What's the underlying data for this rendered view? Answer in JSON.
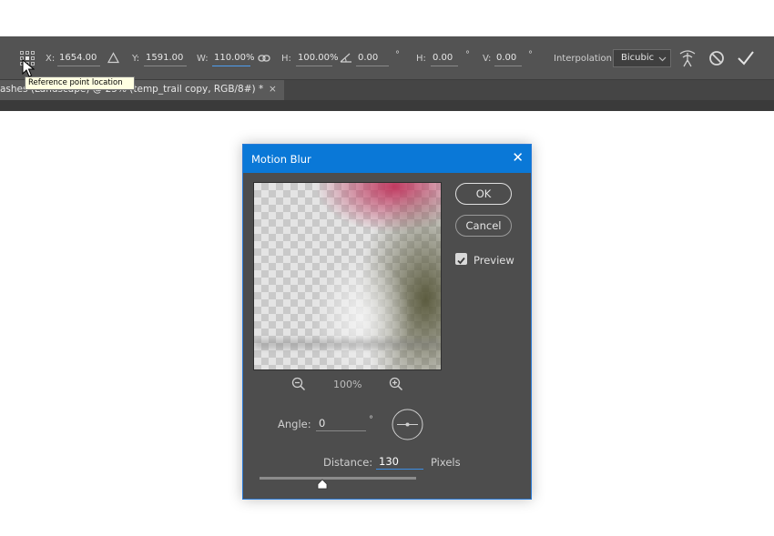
{
  "options_bar": {
    "ref_point_icon": "reference-point-grid-icon",
    "x_label": "X:",
    "x_value": "1654.00 px",
    "delta_icon": "triangle-delta-icon",
    "y_label": "Y:",
    "y_value": "1591.00 px",
    "w_label": "W:",
    "w_value": "110.00%",
    "link_icon": "chain-link-icon",
    "h_label": "H:",
    "h_value": "100.00%",
    "rotate_icon": "angle-icon",
    "rotate_value": "0.00",
    "rotate_unit": "°",
    "hskew_label": "H:",
    "hskew_value": "0.00",
    "hskew_unit": "°",
    "vskew_label": "V:",
    "vskew_value": "0.00",
    "vskew_unit": "°",
    "interpolation_label": "Interpolation:",
    "interpolation_value": "Bicubic",
    "warp_icon": "warp-mode-icon",
    "cancel_icon": "cancel-transform-icon",
    "commit_icon": "commit-transform-icon"
  },
  "tooltip": {
    "text": "Reference point location"
  },
  "document_tab": {
    "title": "ashes (Landscape) @ 25% (temp_trail copy, RGB/8#) *",
    "close": "×"
  },
  "dialog": {
    "title": "Motion Blur",
    "close": "✕",
    "ok_label": "OK",
    "cancel_label": "Cancel",
    "preview_label": "Preview",
    "preview_checked": true,
    "zoom_percent": "100%",
    "angle_label": "Angle:",
    "angle_value": "0",
    "angle_unit": "°",
    "distance_label": "Distance:",
    "distance_value": "130",
    "distance_unit": "Pixels",
    "distance_slider_fraction": 0.4
  }
}
